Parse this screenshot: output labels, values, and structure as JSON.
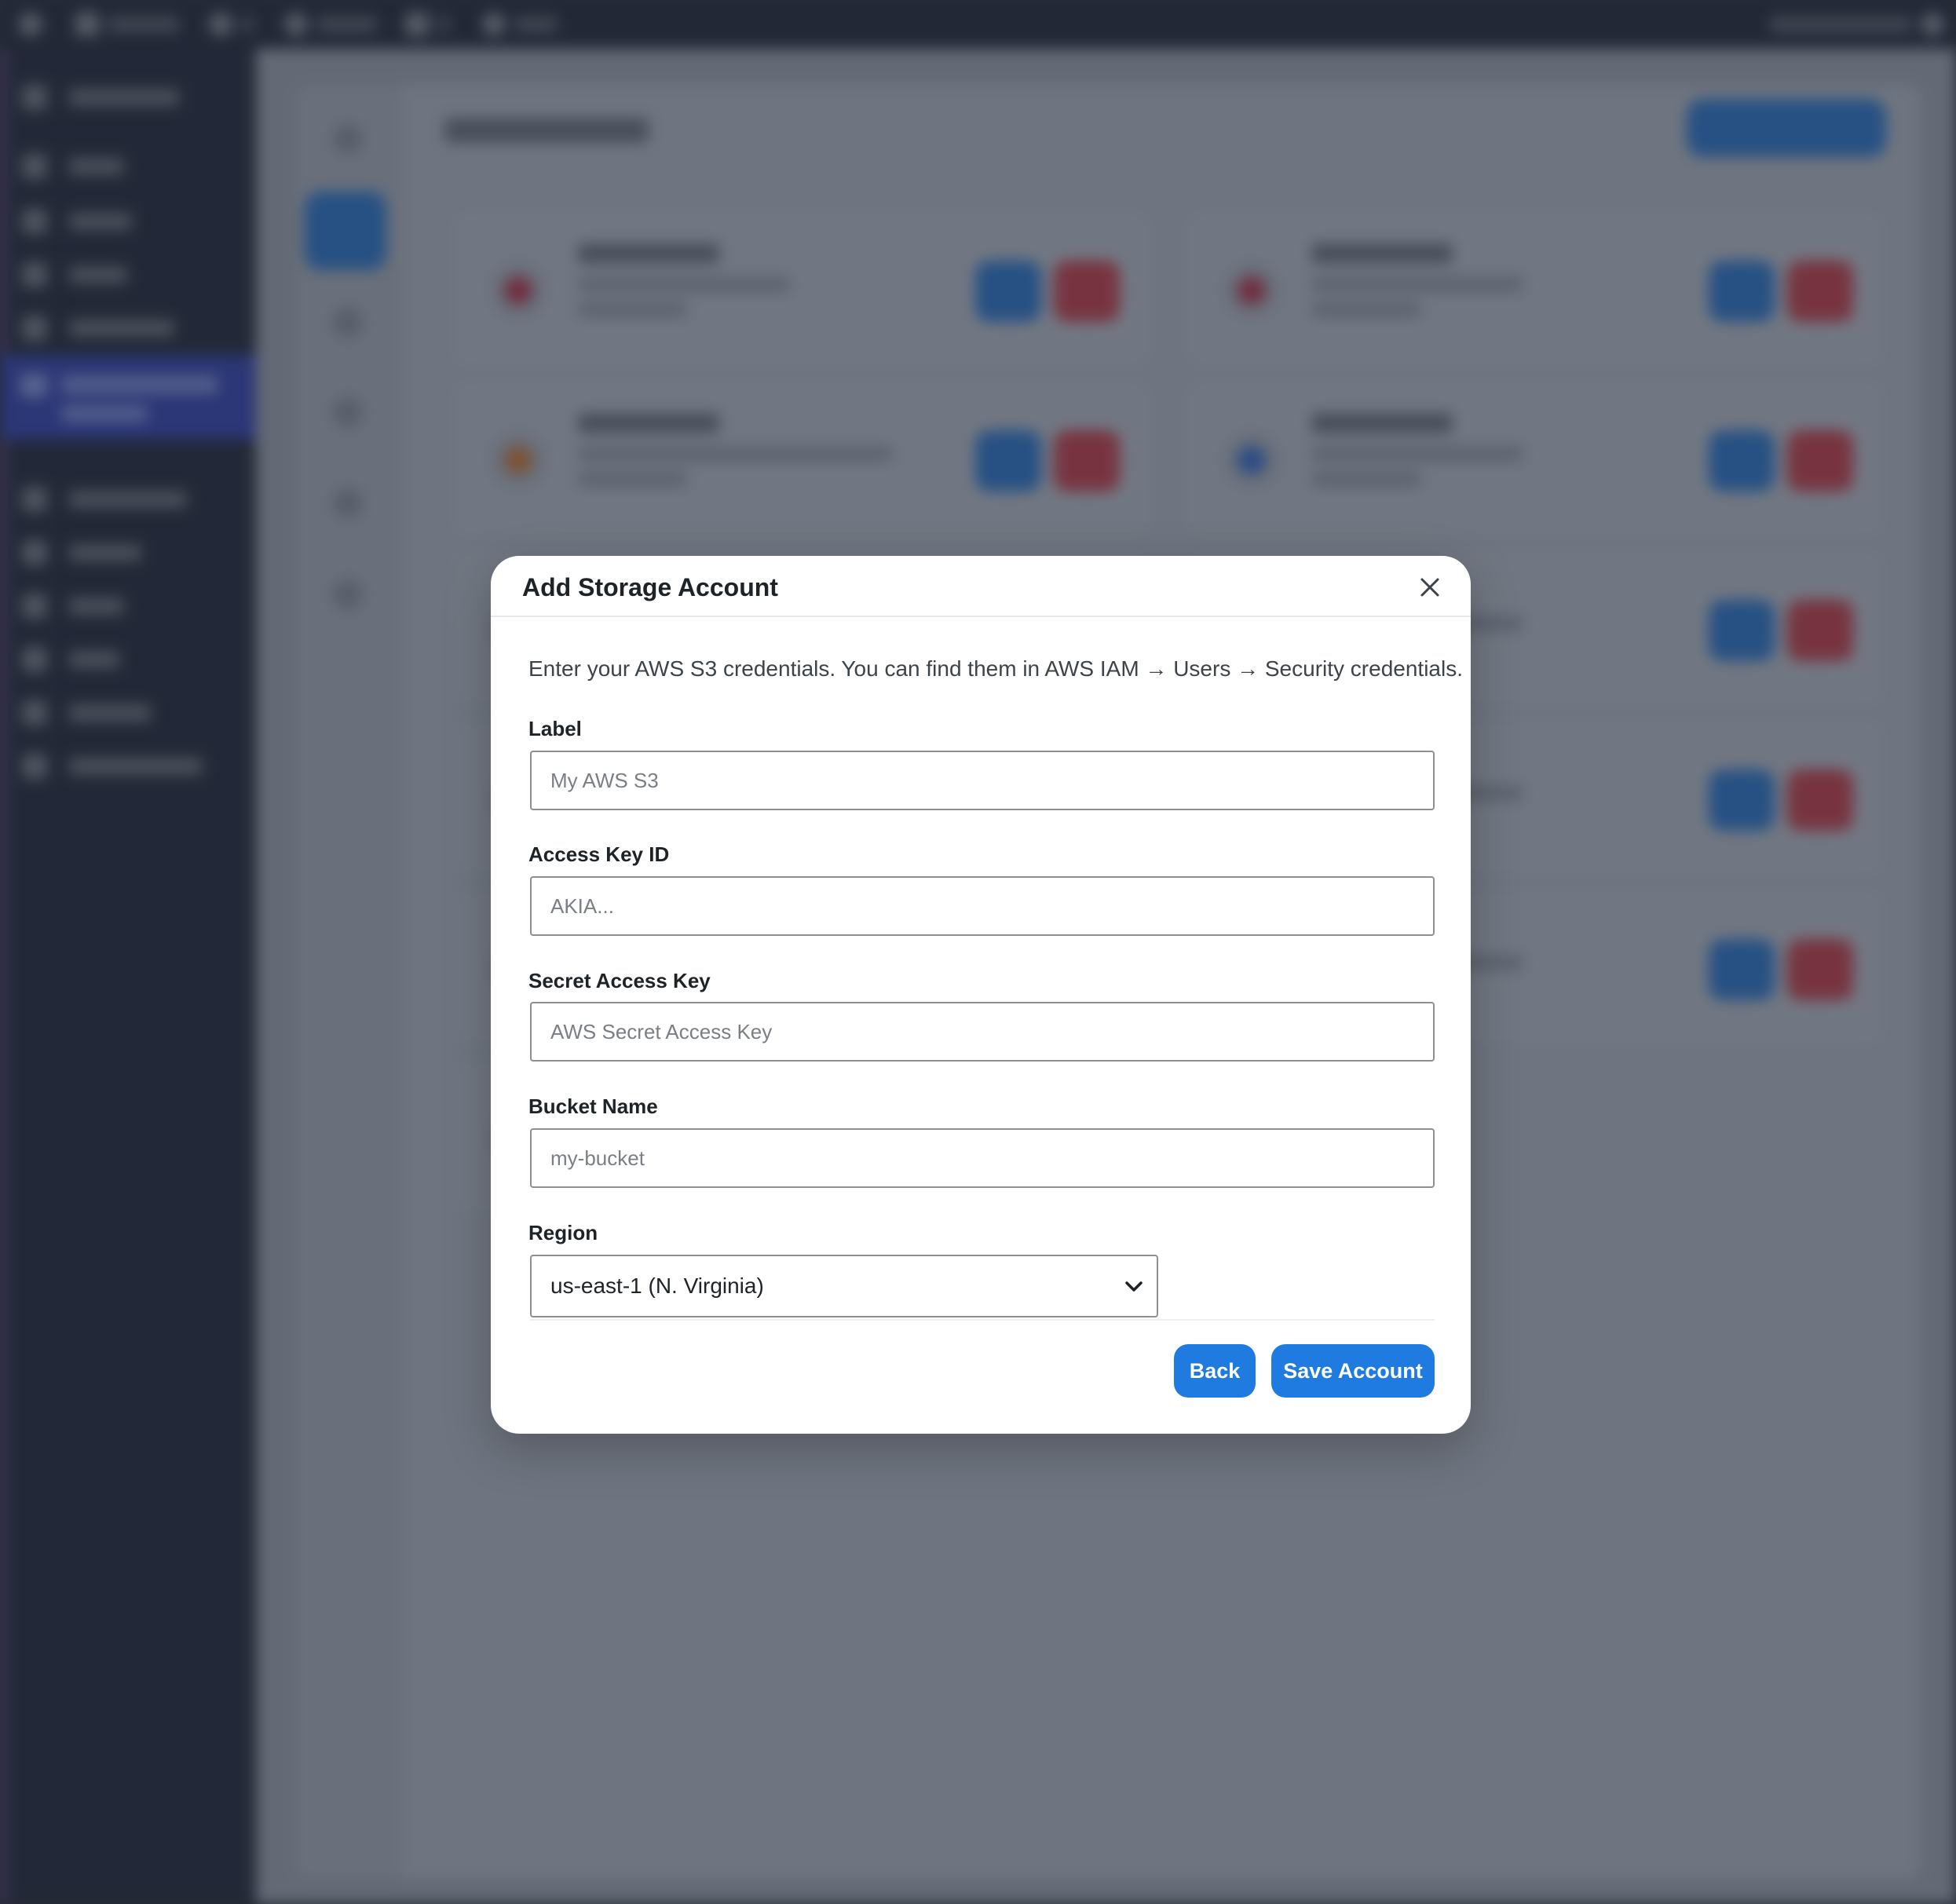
{
  "background": {
    "admin_bar": {
      "items": [
        "wp-logo-icon",
        "site-home-icon",
        "updates-icon",
        "search-icon",
        "comments-icon",
        "new-content-icon"
      ],
      "account_icon": "user-avatar-icon"
    },
    "sidebar": {
      "items": [
        {
          "icon": "dashboard-icon"
        },
        {
          "icon": "posts-icon"
        },
        {
          "icon": "media-icon"
        },
        {
          "icon": "pages-icon"
        },
        {
          "icon": "comments-icon"
        },
        {
          "icon": "storage-icon",
          "active": true
        },
        {
          "icon": "appearance-icon"
        },
        {
          "icon": "plugins-icon"
        },
        {
          "icon": "users-icon"
        },
        {
          "icon": "tools-icon"
        },
        {
          "icon": "settings-icon"
        },
        {
          "icon": "collapse-icon"
        }
      ]
    },
    "accent_color": "#2177d6",
    "danger_color": "#d6363f"
  },
  "modal": {
    "title": "Add Storage Account",
    "description": "Enter your AWS S3 credentials. You can find them in AWS IAM → Users → Security credentials.",
    "fields": {
      "label": {
        "label": "Label",
        "placeholder": "My AWS S3",
        "value": ""
      },
      "access_key_id": {
        "label": "Access Key ID",
        "placeholder": "AKIA...",
        "value": ""
      },
      "secret_access_key": {
        "label": "Secret Access Key",
        "placeholder": "AWS Secret Access Key",
        "value": ""
      },
      "bucket_name": {
        "label": "Bucket Name",
        "placeholder": "my-bucket",
        "value": ""
      },
      "region": {
        "label": "Region",
        "selected": "us-east-1 (N. Virginia)"
      }
    },
    "buttons": {
      "back": "Back",
      "save": "Save Account"
    },
    "close_icon": "close-icon",
    "primary_color": "#1f7be0"
  }
}
